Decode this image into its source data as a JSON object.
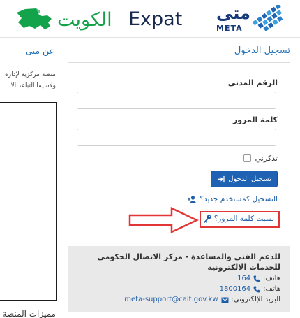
{
  "header": {
    "brand_ar": "الكويت",
    "brand_en": "Expat",
    "meta_ar": "متى",
    "meta_en": "META"
  },
  "login": {
    "title": "تسجيل الدخول",
    "civil_id_label": "الرقم المدني",
    "civil_id_value": "",
    "password_label": "كلمة المرور",
    "password_value": "",
    "remember_label": "تذكرني",
    "login_button": "تسجيل الدخول",
    "register_link": "التسجيل كمستخدم جديد؟",
    "forgot_link": "نسيت كلمة المرور؟"
  },
  "support": {
    "title": "للدعم الفني والمساعدة - مركز الاتصال الحكومي للخدمات الالكترونية",
    "phone1_label": "هاتف:",
    "phone1_value": "164",
    "phone2_label": "هاتف:",
    "phone2_value": "1800164",
    "email_label": "البريد الإلكتروني:",
    "email_value": "meta-support@cait.gov.kw"
  },
  "about": {
    "title": "عن متى",
    "line1": "منصة مركزية لإدارة",
    "line2": "ولاسيما التباعد الا",
    "bottom_heading": "مميزات المنصة"
  },
  "colors": {
    "primary_blue": "#1f62b4",
    "link_blue": "#1e5ea8",
    "highlight_red": "#e23535",
    "kuwait_green": "#13a34a"
  },
  "icons": {
    "login_button_icon": "sign-in-icon",
    "register_icon": "user-plus-icon",
    "forgot_icon": "key-icon",
    "phone_icon": "phone-icon",
    "email_icon": "envelope-icon",
    "arrow": "arrow-right-icon"
  }
}
